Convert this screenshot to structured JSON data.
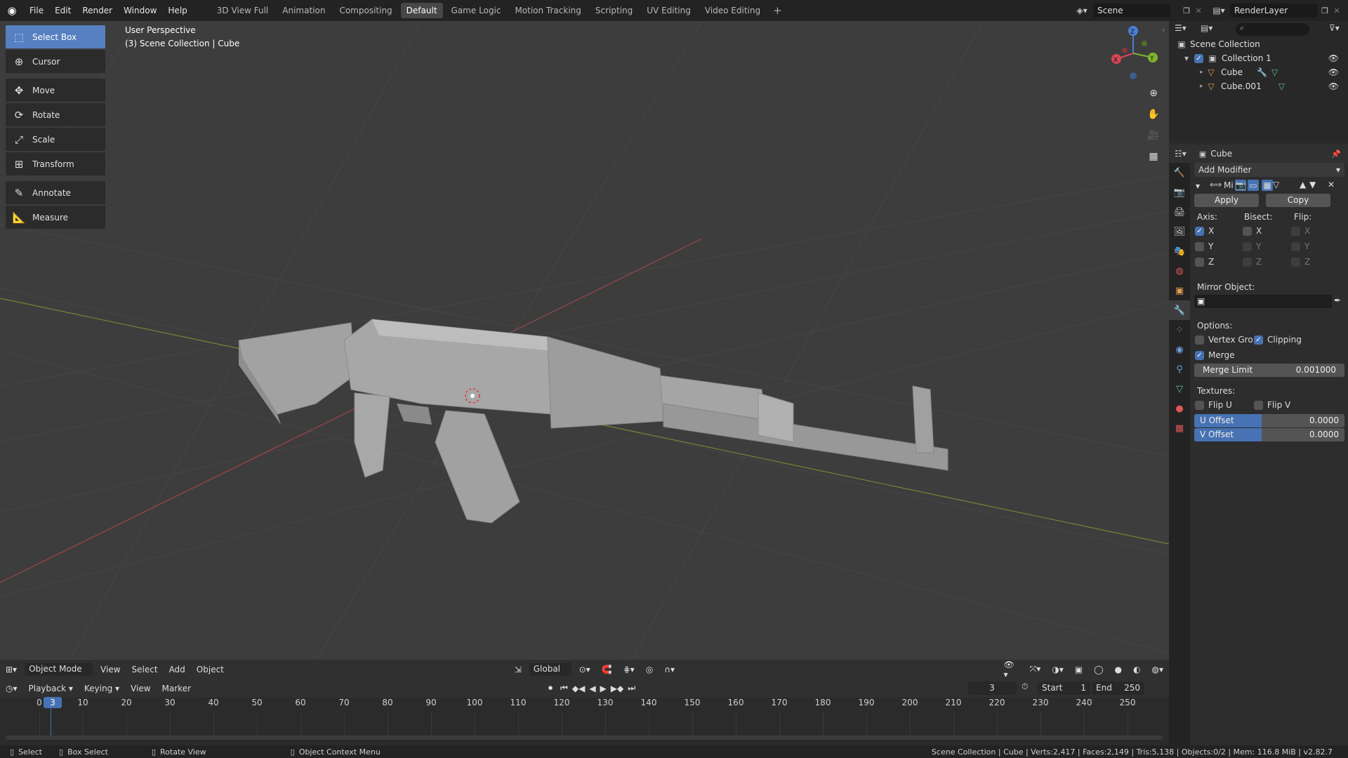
{
  "topbar": {
    "menus": [
      "File",
      "Edit",
      "Render",
      "Window",
      "Help"
    ],
    "workspaces": [
      "3D View Full",
      "Animation",
      "Compositing",
      "Default",
      "Game Logic",
      "Motion Tracking",
      "Scripting",
      "UV Editing",
      "Video Editing"
    ],
    "active_workspace": "Default",
    "add_label": "+",
    "scene": "Scene",
    "render_layer": "RenderLayer"
  },
  "viewport": {
    "perspective": "User Perspective",
    "collection_info": "(3) Scene Collection | Cube"
  },
  "tools": [
    "Select Box",
    "Cursor",
    "Move",
    "Rotate",
    "Scale",
    "Transform",
    "Annotate",
    "Measure"
  ],
  "gizmo": {
    "x": "X",
    "y": "Y",
    "z": "Z"
  },
  "vp_header": {
    "mode": "Object Mode",
    "menus": [
      "View",
      "Select",
      "Add",
      "Object"
    ],
    "orientation": "Global"
  },
  "timeline": {
    "menus": [
      "Playback",
      "Keying",
      "View",
      "Marker"
    ],
    "current_frame": "3",
    "start_label": "Start",
    "start": "1",
    "end_label": "End",
    "end": "250",
    "ticks": [
      "0",
      "10",
      "20",
      "30",
      "40",
      "50",
      "60",
      "70",
      "80",
      "90",
      "100",
      "110",
      "120",
      "130",
      "140",
      "150",
      "160",
      "170",
      "180",
      "190",
      "200",
      "210",
      "220",
      "230",
      "240",
      "250"
    ]
  },
  "statusbar": {
    "select": "Select",
    "box_select": "Box Select",
    "rotate_view": "Rotate View",
    "context_menu": "Object Context Menu",
    "stats": "Scene Collection | Cube | Verts:2,417 | Faces:2,149 | Tris:5,138 | Objects:0/2 | Mem: 116.8 MiB | v2.82.7"
  },
  "outliner": {
    "root": "Scene Collection",
    "collection": "Collection 1",
    "objects": [
      "Cube",
      "Cube.001"
    ]
  },
  "properties": {
    "object_name": "Cube",
    "add_modifier": "Add Modifier",
    "modifier_name": "Mi",
    "apply": "Apply",
    "copy": "Copy",
    "axis_label": "Axis:",
    "bisect_label": "Bisect:",
    "flip_label": "Flip:",
    "axes": [
      "X",
      "Y",
      "Z"
    ],
    "mirror_object_label": "Mirror Object:",
    "options_label": "Options:",
    "vertex_groups": "Vertex Gro...",
    "clipping": "Clipping",
    "merge": "Merge",
    "merge_limit_label": "Merge Limit",
    "merge_limit": "0.001000",
    "textures_label": "Textures:",
    "flip_u": "Flip U",
    "flip_v": "Flip V",
    "u_offset_label": "U Offset",
    "u_offset": "0.0000",
    "v_offset_label": "V Offset",
    "v_offset": "0.0000"
  }
}
